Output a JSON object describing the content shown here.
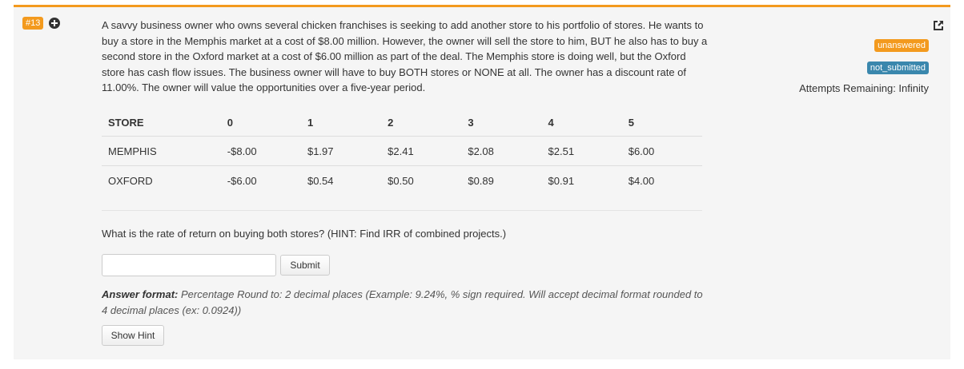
{
  "question": {
    "number": "#13",
    "text": "A savvy business owner who owns several chicken franchises is seeking to add another store to his portfolio of stores. He wants to buy a store in the Memphis market at a cost of $8.00 million. However, the owner will sell the store to him, BUT he also has to buy a second store in the Oxford market at a cost of $6.00 million as part of the deal. The Memphis store is doing well, but the Oxford store has cash flow issues. The business owner will have to buy BOTH stores or NONE at all. The owner has a discount rate of 11.00%. The owner will value the opportunities over a five-year period.",
    "prompt": "What is the rate of return on buying both stores? (HINT: Find IRR of combined projects.)"
  },
  "table": {
    "headers": [
      "STORE",
      "0",
      "1",
      "2",
      "3",
      "4",
      "5"
    ],
    "rows": [
      [
        "MEMPHIS",
        "-$8.00",
        "$1.97",
        "$2.41",
        "$2.08",
        "$2.51",
        "$6.00"
      ],
      [
        "OXFORD",
        "-$6.00",
        "$0.54",
        "$0.50",
        "$0.89",
        "$0.91",
        "$4.00"
      ]
    ]
  },
  "answer": {
    "input_value": "",
    "submit_label": "Submit",
    "format_label": "Answer format:",
    "format_text": "Percentage Round to: 2 decimal places (Example: 9.24%, % sign required. Will accept decimal format rounded to 4 decimal places (ex: 0.0924))",
    "hint_label": "Show Hint"
  },
  "status": {
    "badge_unanswered": "unanswered",
    "badge_not_submitted": "not_submitted",
    "attempts": "Attempts Remaining: Infinity"
  },
  "icons": {
    "expand": "plus-circle-icon",
    "share": "share-icon"
  },
  "colors": {
    "accent": "#f39a1e",
    "info": "#3a87ad",
    "panel_bg": "#f5f5f5"
  }
}
